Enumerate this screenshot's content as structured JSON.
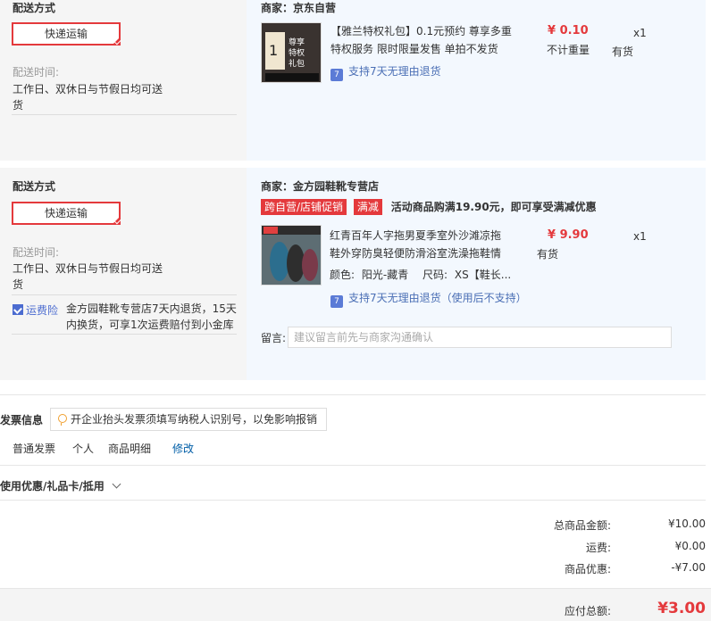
{
  "order1": {
    "shipping_label": "配送方式",
    "shipping_method": "快递运输",
    "delivery_time_label": "配送时间:",
    "delivery_time_value_line1": "工作日、双休日与节假日均可送",
    "delivery_time_value_line2": "货",
    "merchant": "商家：京东自营",
    "item": {
      "title_line1": "【雅兰特权礼包】0.1元预约 尊享多重",
      "title_line2": "特权服务 限时限量发售 单拍不发货",
      "price": "¥ 0.10",
      "weight": "不计重量",
      "qty": "x1",
      "stock": "有货",
      "return_policy": "支持7天无理由退货",
      "thumb_text": "特权礼包"
    }
  },
  "order2": {
    "shipping_label": "配送方式",
    "shipping_method": "快递运输",
    "delivery_time_label": "配送时间:",
    "delivery_time_value_line1": "工作日、双休日与节假日均可送",
    "delivery_time_value_line2": "货",
    "insurance_label": "运费险",
    "insurance_line1": "金方园鞋靴专营店7天内退货，15天",
    "insurance_line2": "内换货，可享1次运费赔付到小金库",
    "merchant": "商家：金方园鞋靴专营店",
    "promo_tag1": "跨自营/店铺促销",
    "promo_tag2": "满减",
    "promo_text": "活动商品购满19.90元，即可享受满减优惠",
    "item": {
      "title_line1": "红青百年人字拖男夏季室外沙滩凉拖",
      "title_line2": "鞋外穿防臭轻便防滑浴室洗澡拖鞋情",
      "color_label": "颜色:",
      "color_value": "阳光-藏青",
      "size_label": "尺码:",
      "size_value": "XS【鞋长...",
      "price": "¥ 9.90",
      "qty": "x1",
      "stock": "有货",
      "return_policy": "支持7天无理由退货（使用后不支持）"
    },
    "remark_label": "留言:",
    "remark_placeholder": "建议留言前先与商家沟通确认"
  },
  "invoice": {
    "heading": "发票信息",
    "tip": "开企业抬头发票须填写纳税人识别号，以免影响报销",
    "type": "普通发票",
    "title": "个人",
    "content": "商品明细",
    "edit": "修改"
  },
  "coupon": {
    "heading": "使用优惠/礼品卡/抵用"
  },
  "summary": {
    "goods_total_label": "总商品金额:",
    "goods_total": "¥10.00",
    "freight_label": "运费:",
    "freight": "¥0.00",
    "discount_label": "商品优惠:",
    "discount": "-¥7.00",
    "payable_label": "应付总额:",
    "payable": "¥3.00"
  },
  "colors": {
    "accent": "#e4393c",
    "link": "#4b6fb5",
    "panel_gray": "#f5f5f5",
    "panel_blue": "#f3f8fe"
  }
}
